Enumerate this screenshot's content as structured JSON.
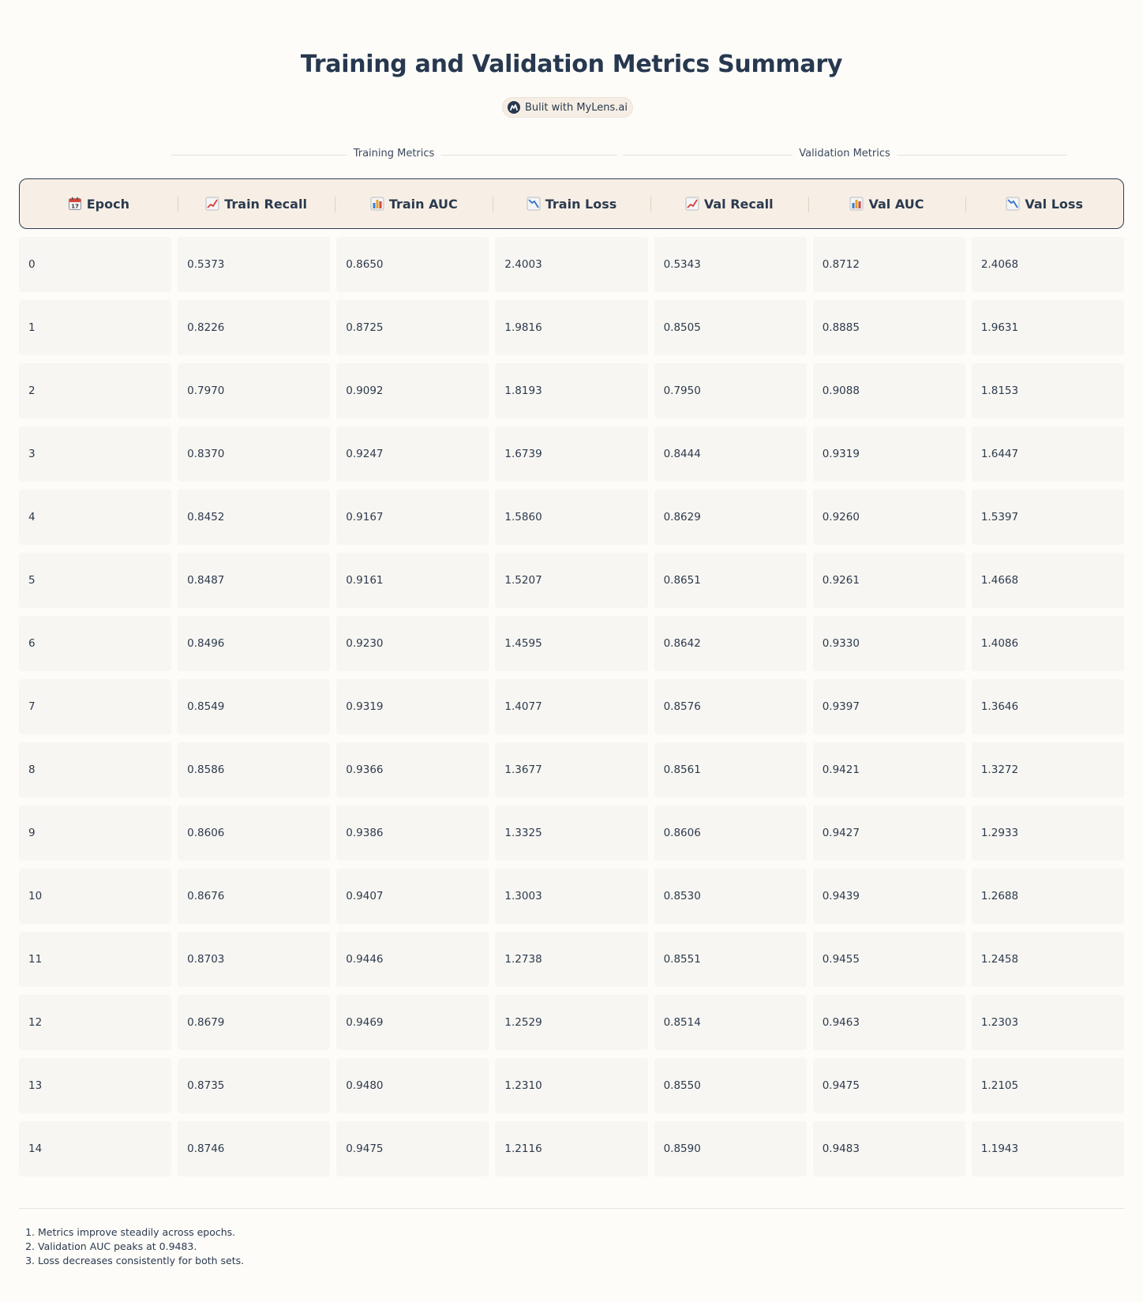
{
  "title": "Training and Validation Metrics Summary",
  "badge": "Bulit with MyLens.ai",
  "groups": {
    "training": "Training Metrics",
    "validation": "Validation Metrics"
  },
  "headers": [
    {
      "icon": "calendar-icon",
      "label": "Epoch"
    },
    {
      "icon": "chart-up-icon",
      "label": "Train Recall"
    },
    {
      "icon": "bar-chart-icon",
      "label": "Train AUC"
    },
    {
      "icon": "chart-down-icon",
      "label": "Train Loss"
    },
    {
      "icon": "chart-up-icon",
      "label": "Val Recall"
    },
    {
      "icon": "bar-chart-icon",
      "label": "Val AUC"
    },
    {
      "icon": "chart-down-icon",
      "label": "Val Loss"
    }
  ],
  "chart_data": {
    "type": "table",
    "columns": [
      "Epoch",
      "Train Recall",
      "Train AUC",
      "Train Loss",
      "Val Recall",
      "Val AUC",
      "Val Loss"
    ],
    "rows": [
      [
        "0",
        "0.5373",
        "0.8650",
        "2.4003",
        "0.5343",
        "0.8712",
        "2.4068"
      ],
      [
        "1",
        "0.8226",
        "0.8725",
        "1.9816",
        "0.8505",
        "0.8885",
        "1.9631"
      ],
      [
        "2",
        "0.7970",
        "0.9092",
        "1.8193",
        "0.7950",
        "0.9088",
        "1.8153"
      ],
      [
        "3",
        "0.8370",
        "0.9247",
        "1.6739",
        "0.8444",
        "0.9319",
        "1.6447"
      ],
      [
        "4",
        "0.8452",
        "0.9167",
        "1.5860",
        "0.8629",
        "0.9260",
        "1.5397"
      ],
      [
        "5",
        "0.8487",
        "0.9161",
        "1.5207",
        "0.8651",
        "0.9261",
        "1.4668"
      ],
      [
        "6",
        "0.8496",
        "0.9230",
        "1.4595",
        "0.8642",
        "0.9330",
        "1.4086"
      ],
      [
        "7",
        "0.8549",
        "0.9319",
        "1.4077",
        "0.8576",
        "0.9397",
        "1.3646"
      ],
      [
        "8",
        "0.8586",
        "0.9366",
        "1.3677",
        "0.8561",
        "0.9421",
        "1.3272"
      ],
      [
        "9",
        "0.8606",
        "0.9386",
        "1.3325",
        "0.8606",
        "0.9427",
        "1.2933"
      ],
      [
        "10",
        "0.8676",
        "0.9407",
        "1.3003",
        "0.8530",
        "0.9439",
        "1.2688"
      ],
      [
        "11",
        "0.8703",
        "0.9446",
        "1.2738",
        "0.8551",
        "0.9455",
        "1.2458"
      ],
      [
        "12",
        "0.8679",
        "0.9469",
        "1.2529",
        "0.8514",
        "0.9463",
        "1.2303"
      ],
      [
        "13",
        "0.8735",
        "0.9480",
        "1.2310",
        "0.8550",
        "0.9475",
        "1.2105"
      ],
      [
        "14",
        "0.8746",
        "0.9475",
        "1.2116",
        "0.8590",
        "0.9483",
        "1.1943"
      ]
    ]
  },
  "notes": [
    "Metrics improve steadily across epochs.",
    "Validation AUC peaks at 0.9483.",
    "Loss decreases consistently for both sets."
  ]
}
